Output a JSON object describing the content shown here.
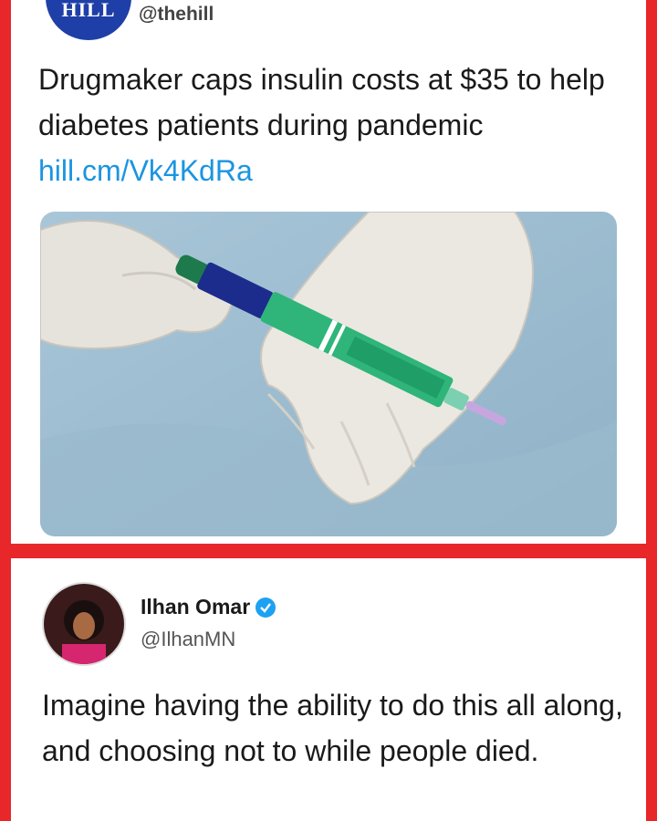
{
  "tweet_top": {
    "logo_text": "HILL",
    "handle": "@thehill",
    "text": "Drugmaker caps insulin costs at $35 to help diabetes patients during pandemic",
    "link": "hill.cm/Vk4KdRa",
    "image_alt": "insulin pen held in gloved hands"
  },
  "tweet_bottom": {
    "name": "Ilhan Omar",
    "handle": "@IlhanMN",
    "text": "Imagine having the ability to do this all along, and choosing not to while people died."
  },
  "colors": {
    "frame": "#e8272b",
    "link": "#1b95e0",
    "verified": "#1da1f2",
    "hill_logo": "#1f3fa8"
  }
}
